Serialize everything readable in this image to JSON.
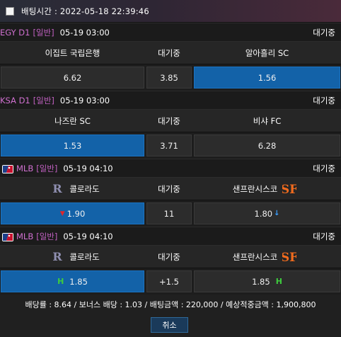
{
  "header": {
    "label": "배팅시간 : 2022-05-18 22:39:46"
  },
  "matches": [
    {
      "league": "EGY D1",
      "bet_type": "[일반]",
      "time": "05-19 03:00",
      "status": "대기중",
      "home": "이집트 국립은행",
      "mid_label": "대기중",
      "away": "알아흘리 SC",
      "odds_home": "6.62",
      "odds_mid": "3.85",
      "odds_away": "1.56",
      "selected": "away"
    },
    {
      "league": "KSA D1",
      "bet_type": "[일반]",
      "time": "05-19 03:00",
      "status": "대기중",
      "home": "나즈란 SC",
      "mid_label": "대기중",
      "away": "비샤 FC",
      "odds_home": "1.53",
      "odds_mid": "3.71",
      "odds_away": "6.28",
      "selected": "home"
    },
    {
      "league": "MLB",
      "bet_type": "[일반]",
      "time": "05-19 04:10",
      "status": "대기중",
      "home": "콜로라도",
      "mid_label": "대기중",
      "away": "샌프란시스코",
      "odds_home": "1.90",
      "odds_mid": "11",
      "odds_away": "1.80",
      "selected": "home",
      "home_indicator": "down-red-arrow",
      "away_indicator": "down-blue-arrow"
    },
    {
      "league": "MLB",
      "bet_type": "[일반]",
      "time": "05-19 04:10",
      "status": "대기중",
      "home": "콜로라도",
      "mid_label": "대기중",
      "away": "샌프란시스코",
      "odds_home": "1.85",
      "odds_mid": "+1.5",
      "odds_away": "1.85",
      "selected": "home",
      "home_marker": "H",
      "away_marker": "H"
    }
  ],
  "summary": "배당률 : 8.64 / 보너스 배당 : 1.03 / 배팅금액 : 220,000 / 예상적중금액 : 1,900,800",
  "cancel_label": "취소",
  "colors": {
    "selected": "#1362a8",
    "league": "#d070d0",
    "handicap_marker": "#3ecc3e",
    "arrow_down_red": "#e0262b",
    "arrow_down_blue": "#3aa0ff"
  }
}
